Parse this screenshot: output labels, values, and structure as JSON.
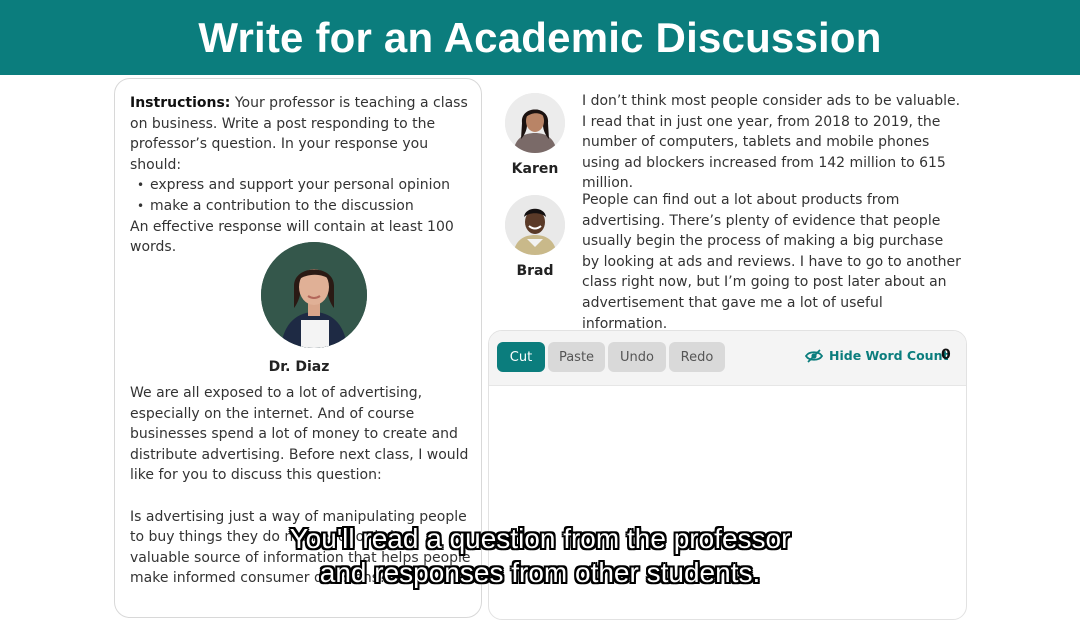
{
  "header": {
    "title": "Write for an Academic Discussion"
  },
  "instructions": {
    "label": "Instructions:",
    "text": " Your professor is teaching a class on business. Write a post responding to the professor’s question. In your response you should:",
    "bullets": [
      "express and support your personal opinion",
      "make a contribution to the discussion"
    ],
    "closing": "An effective response will contain at least 100 words."
  },
  "professor": {
    "name": "Dr. Diaz",
    "paragraph1": "We are all exposed to a lot of advertising, especially on the internet. And of course businesses spend a lot of money to create and distribute advertising. Before next class, I would like for you to discuss this question:",
    "paragraph2": "Is advertising just a way of manipulating people to buy things they do not need, or is it a valuable source of information that helps people make informed consumer decisions?"
  },
  "students": [
    {
      "name": "Karen",
      "post": "I don’t think most people consider ads to be valuable. I read that in just one year, from 2018 to 2019, the number of computers, tablets and mobile phones using ad blockers increased from 142 million to 615 million."
    },
    {
      "name": "Brad",
      "post": "People can find out a lot about products from advertising. There’s plenty of evidence that people usually begin the process of making a big purchase by looking at ads and reviews. I have to go to another class right now, but I’m going to post later about an advertisement that gave me a lot of useful information."
    }
  ],
  "editor": {
    "buttons": {
      "cut": "Cut",
      "paste": "Paste",
      "undo": "Undo",
      "redo": "Redo"
    },
    "hide_word_count": "Hide Word Count",
    "word_count": "0",
    "text": ""
  },
  "caption": {
    "line1": "You'll read a question from the professor",
    "line2": "and responses from other students."
  },
  "colors": {
    "accent": "#0b7d7d",
    "button_inactive": "#d9d9d9"
  },
  "icons": {
    "hide_word_count": "eye-slash-icon"
  }
}
